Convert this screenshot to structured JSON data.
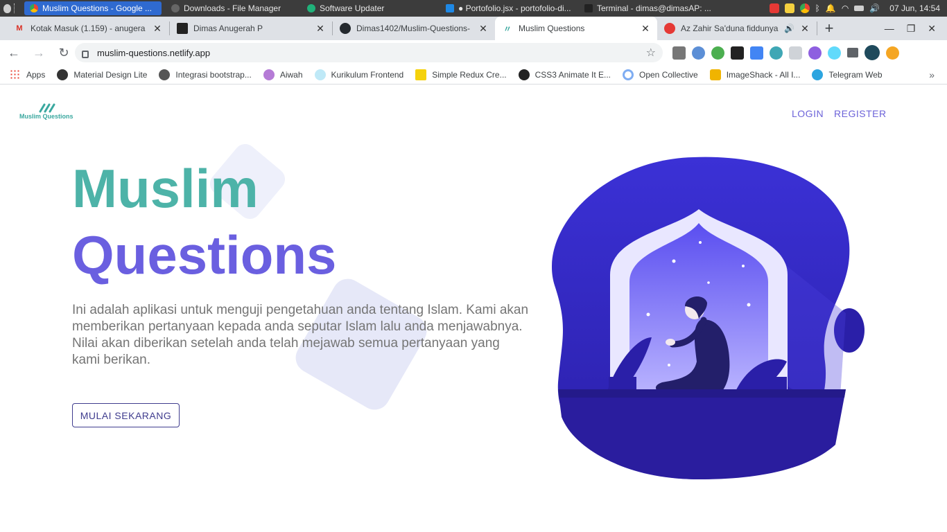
{
  "taskbar": {
    "tasks": [
      {
        "label": "Muslim Questions - Google ..."
      },
      {
        "label": "Downloads - File Manager"
      },
      {
        "label": "Software Updater"
      },
      {
        "label": "● Portofolio.jsx - portofolio-di..."
      },
      {
        "label": "Terminal - dimas@dimasAP: ..."
      }
    ],
    "clock": "07 Jun, 14:54"
  },
  "tabs": [
    {
      "title": "Kotak Masuk (1.159) - anugera"
    },
    {
      "title": "Dimas Anugerah P"
    },
    {
      "title": "Dimas1402/Muslim-Questions-"
    },
    {
      "title": "Muslim Questions"
    },
    {
      "title": "Az Zahir Sa'duna fiddunya"
    }
  ],
  "toolbar": {
    "url": "muslim-questions.netlify.app"
  },
  "bookmarks": [
    {
      "label": "Apps"
    },
    {
      "label": "Material Design Lite"
    },
    {
      "label": "Integrasi bootstrap..."
    },
    {
      "label": "Aiwah"
    },
    {
      "label": "Kurikulum Frontend"
    },
    {
      "label": "Simple Redux Cre..."
    },
    {
      "label": "CSS3 Animate It E..."
    },
    {
      "label": "Open Collective"
    },
    {
      "label": "ImageShack - All I..."
    },
    {
      "label": "Telegram Web"
    }
  ],
  "page": {
    "logo_text": "Muslim Questions",
    "nav": {
      "login": "LOGIN",
      "register": "REGISTER"
    },
    "hero": {
      "line1": "Muslim",
      "line2": "Questions",
      "description": "Ini adalah aplikasi untuk menguji pengetahuan anda tentang Islam. Kami akan memberikan pertanyaan kepada anda seputar Islam lalu anda menjawabnya. Nilai akan diberikan setelah anda telah mejawab semua pertanyaan yang kami berikan.",
      "cta": "MULAI SEKARANG"
    }
  },
  "colors": {
    "teal": "#4db3a8",
    "purple": "#6a5fe0",
    "nav_purple": "#6c63d9",
    "illustration_blue": "#3a2fd0"
  }
}
